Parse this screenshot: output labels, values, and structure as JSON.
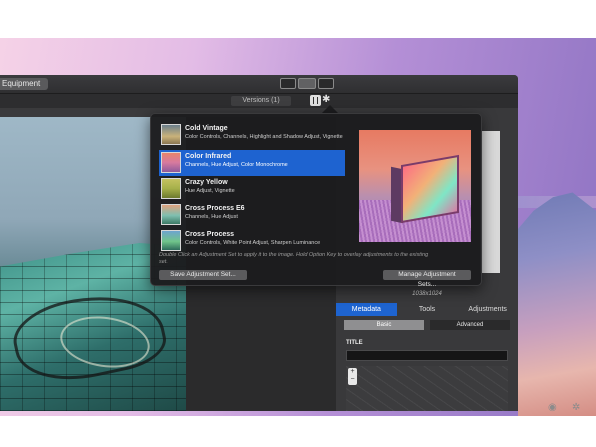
{
  "window": {
    "equipment_tab": "Equipment",
    "versions_label": "Versions (1)"
  },
  "adjustment_sets": {
    "presets": [
      {
        "title": "Cold Vintage",
        "description": "Color Controls, Channels, Highlight and Shadow Adjust, Vignette",
        "selected": false
      },
      {
        "title": "Color Infrared",
        "description": "Channels, Hue Adjust, Color Monochrome",
        "selected": true
      },
      {
        "title": "Crazy Yellow",
        "description": "Hue Adjust, Vignette",
        "selected": false
      },
      {
        "title": "Cross Process E6",
        "description": "Channels, Hue Adjust",
        "selected": false
      },
      {
        "title": "Cross Process",
        "description": "Color Controls, White Point Adjust, Sharpen Luminance",
        "selected": false
      }
    ],
    "hint": "Double Click an Adjustment Set to apply it to the image. Hold Option Key to overlay adjustments to the existing set.",
    "save_button": "Save Adjustment Set...",
    "manage_button": "Manage Adjustment Sets..."
  },
  "inspector": {
    "dimensions": "1038x1024",
    "tabs": [
      "Metadata",
      "Tools",
      "Adjustments"
    ],
    "active_tab": "Metadata",
    "segments": [
      "Basic",
      "Advanced"
    ],
    "active_segment": "Basic",
    "title_label": "TITLE",
    "zoom_in": "+",
    "zoom_out": "−"
  },
  "colors": {
    "selection": "#1e63d0",
    "window_bg": "#3a3a3c",
    "popover_bg": "#1c1c1e"
  },
  "icons": [
    "view-toggle-icon",
    "adjustments-icon",
    "gear-icon",
    "zoom-in-icon",
    "zoom-out-icon"
  ]
}
